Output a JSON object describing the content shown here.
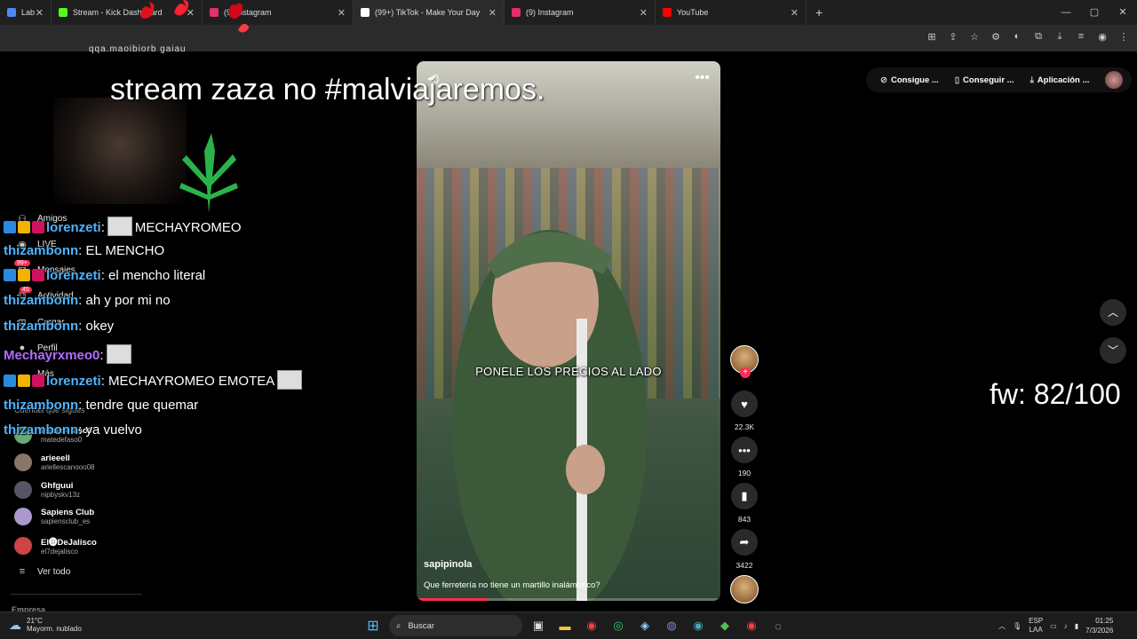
{
  "browser": {
    "tabs": [
      {
        "label": "Lab",
        "color": "#4b8bf5",
        "active": false
      },
      {
        "label": "Stream - Kick Dashboard",
        "color": "#53fc18",
        "active": false
      },
      {
        "label": "(9) Instagram",
        "color": "#e1306c",
        "active": false
      },
      {
        "label": "(99+) TikTok - Make Your Day",
        "color": "#ffffff",
        "active": true
      },
      {
        "label": "(9) Instagram",
        "color": "#e1306c",
        "active": false
      },
      {
        "label": "YouTube",
        "color": "#ff0000",
        "active": false
      }
    ],
    "new_tab": "+",
    "window_controls": [
      "—",
      "▢",
      "✕"
    ],
    "address_icons": [
      "⊞",
      "⇪",
      "☆",
      "⚙",
      "◐",
      "⧉",
      "⤓",
      "≡",
      "◉",
      "⋮"
    ]
  },
  "overlay": {
    "top_text": "qqa.maoibiorb gaiau",
    "stream_title": "stream zaza no #malviajaremos.",
    "fw_counter": "fw: 82/100"
  },
  "sidebar": {
    "items": [
      {
        "label": "Amigos",
        "icon": "friends-icon",
        "glyph": "⚇"
      },
      {
        "label": "LIVE",
        "icon": "live-icon",
        "glyph": "◉"
      },
      {
        "label": "Mensajes",
        "icon": "messages-icon",
        "glyph": "✉"
      },
      {
        "label": "Actividad",
        "icon": "activity-icon",
        "glyph": "⧉"
      },
      {
        "label": "Cargar",
        "icon": "upload-icon",
        "glyph": "⊞"
      },
      {
        "label": "Perfil",
        "icon": "profile-icon",
        "glyph": "●"
      },
      {
        "label": "Más",
        "icon": "more-icon",
        "glyph": "…"
      }
    ],
    "badges": {
      "mensajes": "99+",
      "actividad": "45"
    },
    "following_header": "Cuentas que sigues",
    "accounts": [
      {
        "name": "matedefaso0",
        "handle": "matedefaso0",
        "color": "#6a7"
      },
      {
        "name": "arieeell",
        "handle": "ariellescanooo08",
        "color": "#876"
      },
      {
        "name": "Ghfguui",
        "handle": "nipbyskv13z",
        "color": "#556"
      },
      {
        "name": "Sapiens Club",
        "handle": "sapiensclub_es",
        "color": "#a9c"
      },
      {
        "name": "El🅓DeJalisco",
        "handle": "el7dejalisco",
        "color": "#c44"
      }
    ],
    "see_all": "Ver todo",
    "footer": "Empresa"
  },
  "chat": [
    {
      "user": "lorenzeti",
      "class": "u-blue",
      "badges": true,
      "emote_before": true,
      "msg": "MECHAYROMEO"
    },
    {
      "user": "thizambonn",
      "class": "u-blue",
      "badges": false,
      "emote_before": false,
      "msg": ": EL MENCHO"
    },
    {
      "user": "lorenzeti",
      "class": "u-blue",
      "badges": true,
      "emote_before": false,
      "msg": ": el mencho literal"
    },
    {
      "user": "thizambonn",
      "class": "u-blue",
      "badges": false,
      "emote_before": false,
      "msg": ": ah y por mi no"
    },
    {
      "user": "thizambonn",
      "class": "u-blue",
      "badges": false,
      "emote_before": false,
      "msg": ": okey"
    },
    {
      "user": "Mechayrxmeo0",
      "class": "u-purple",
      "badges": false,
      "emote_before": true,
      "msg": ""
    },
    {
      "user": "lorenzeti",
      "class": "u-blue",
      "badges": true,
      "emote_before": false,
      "msg": ": MECHAYROMEO EMOTEA"
    },
    {
      "user": "thizambonn",
      "class": "u-blue",
      "badges": false,
      "emote_before": false,
      "msg": ": tendre que quemar"
    },
    {
      "user": "thizambonn",
      "class": "u-blue",
      "badges": false,
      "emote_before": false,
      "msg": ": ya vuelvo"
    }
  ],
  "video": {
    "caption": "PONELE LOS PRECIOS AL LADO",
    "author": "sapipinola",
    "description": "Que ferretería no tiene un martillo inalámbrico?",
    "progress": 0.23,
    "more": "•••",
    "mute": "◀)"
  },
  "actions": {
    "likes": "22.3K",
    "comments": "190",
    "saves": "843",
    "shares": "3422"
  },
  "top_buttons": [
    {
      "label": "Consigue ...",
      "icon": "coins-icon",
      "glyph": "⊘"
    },
    {
      "label": "Conseguir ...",
      "icon": "phone-icon",
      "glyph": "▯"
    },
    {
      "label": "Aplicación ...",
      "icon": "download-icon",
      "glyph": "⤓"
    }
  ],
  "taskbar": {
    "temp": "21°C",
    "weather": "Mayorm. nublado",
    "search_placeholder": "Buscar",
    "lang_top": "ESP",
    "lang_bottom": "LAA",
    "time": "01:25",
    "date": "7/3/2026"
  }
}
